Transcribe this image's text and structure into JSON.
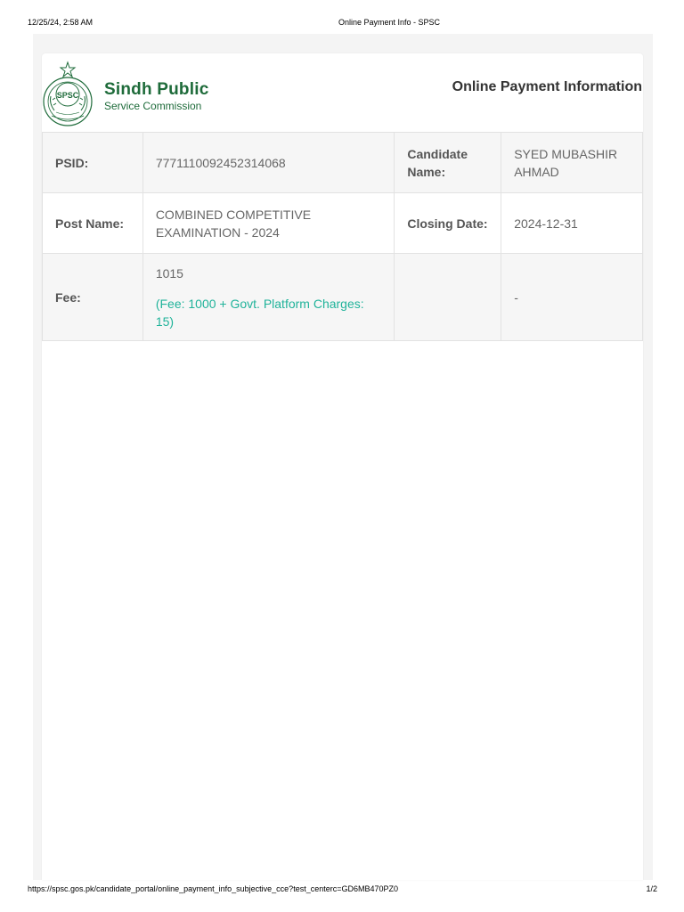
{
  "print_header": {
    "datetime": "12/25/24, 2:58 AM",
    "title": "Online Payment Info - SPSC"
  },
  "org": {
    "name": "Sindh Public",
    "subtitle": "Service Commission",
    "logo_text": "SPSC"
  },
  "page": {
    "heading": "Online Payment Information"
  },
  "info": {
    "psid_label": "PSID:",
    "psid_value": "7771110092452314068",
    "candidate_label": "Candidate Name:",
    "candidate_value": "SYED MUBASHIR AHMAD",
    "post_label": "Post Name:",
    "post_value": "COMBINED COMPETITIVE EXAMINATION - 2024",
    "closing_label": "Closing Date:",
    "closing_value": "2024-12-31",
    "fee_label": "Fee:",
    "fee_value": "1015",
    "fee_detail": "(Fee: 1000 + Govt. Platform Charges: 15)",
    "extra_label": "",
    "extra_value": "-"
  },
  "print_footer": {
    "url": "https://spsc.gos.pk/candidate_portal/online_payment_info_subjective_cce?test_centerc=GD6MB470PZ0",
    "page": "1/2"
  },
  "colors": {
    "brand_green": "#1e6b3a",
    "fee_detail": "#20b39a"
  }
}
